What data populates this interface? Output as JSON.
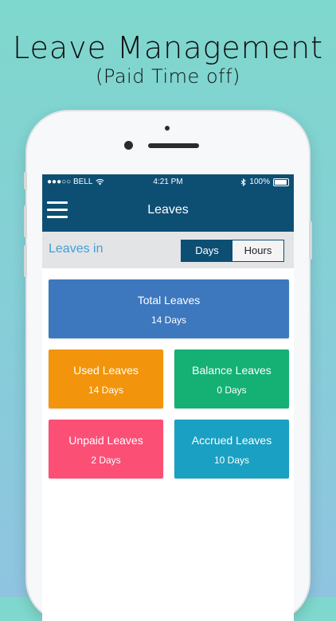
{
  "headline": {
    "title": "Leave Management",
    "subtitle": "(Paid Time off)"
  },
  "status_bar": {
    "carrier": "●●●○○ BELL",
    "time": "4:21 PM",
    "battery": "100%"
  },
  "navbar": {
    "title": "Leaves"
  },
  "filter": {
    "label": "Leaves in",
    "options": [
      "Days",
      "Hours"
    ],
    "selected": "Days"
  },
  "cards": {
    "total": {
      "title": "Total Leaves",
      "value": "14 Days",
      "color": "#3d78be"
    },
    "used": {
      "title": "Used Leaves",
      "value": "14 Days",
      "color": "#f2950c"
    },
    "balance": {
      "title": "Balance Leaves",
      "value": "0 Days",
      "color": "#14b074"
    },
    "unpaid": {
      "title": "Unpaid Leaves",
      "value": "2 Days",
      "color": "#fb4f76"
    },
    "accrued": {
      "title": "Accrued Leaves",
      "value": "10 Days",
      "color": "#1aa0c2"
    }
  },
  "colors": {
    "nav": "#0d4f73",
    "filter_label": "#3fa0d8"
  }
}
